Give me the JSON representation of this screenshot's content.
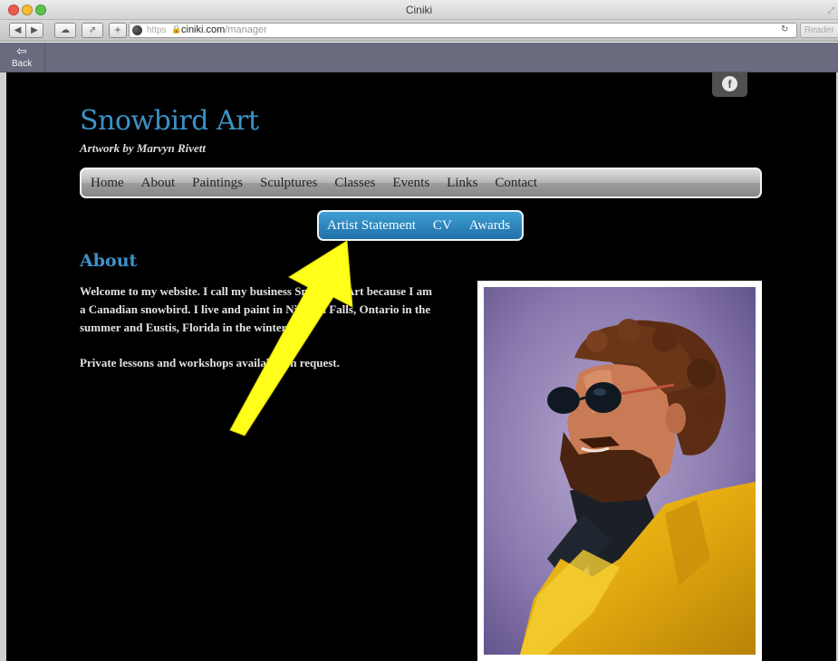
{
  "browser": {
    "window_title": "Ciniki",
    "url_protocol": "https",
    "url_domain": "ciniki.com",
    "url_path": "/manager",
    "reader_label": "Reader"
  },
  "appbar": {
    "back_label": "Back"
  },
  "site": {
    "title": "Snowbird Art",
    "subtitle": "Artwork by Marvyn Rivett",
    "social_icon": "f",
    "nav": [
      "Home",
      "About",
      "Paintings",
      "Sculptures",
      "Classes",
      "Events",
      "Links",
      "Contact"
    ],
    "subnav": [
      "Artist Statement",
      "CV",
      "Awards"
    ],
    "about": {
      "heading": "About",
      "paragraph_1": "Welcome to my website. I call my business Snowbird Art because I am a Canadian snowbird. I live and paint in Niagara Falls, Ontario in the summer and Eustis, Florida in the winter.",
      "paragraph_2": "Private lessons and workshops available on request."
    }
  },
  "colors": {
    "site_background": "#000000",
    "title_blue": "#3d92c8",
    "subnav_blue": "#2a86bf",
    "annotation_arrow": "#ffff1a"
  }
}
